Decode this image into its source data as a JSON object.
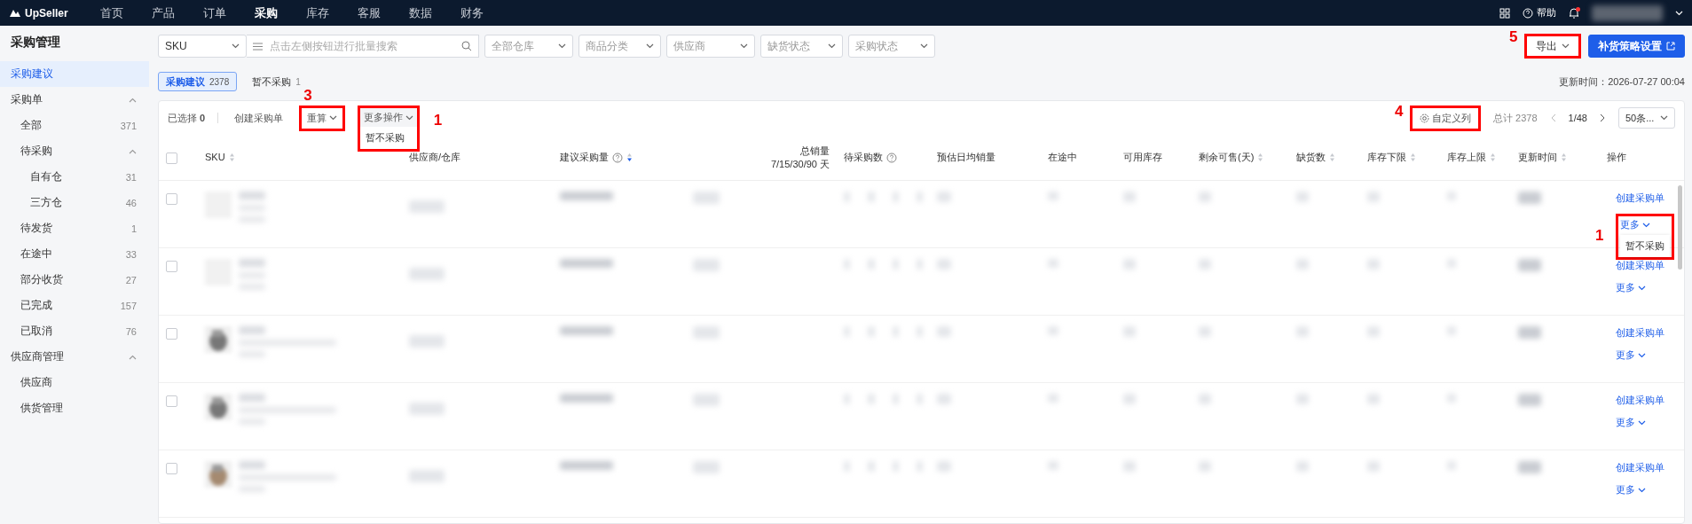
{
  "topbar": {
    "logo": "UpSeller",
    "nav": [
      {
        "label": "首页",
        "selected": false
      },
      {
        "label": "产品",
        "selected": false
      },
      {
        "label": "订单",
        "selected": false
      },
      {
        "label": "采购",
        "selected": true
      },
      {
        "label": "库存",
        "selected": false
      },
      {
        "label": "客服",
        "selected": false
      },
      {
        "label": "数据",
        "selected": false
      },
      {
        "label": "财务",
        "selected": false
      }
    ],
    "help": "帮助",
    "notification_dot": true
  },
  "sidebar": {
    "title": "采购管理",
    "items": [
      {
        "label": "采购建议",
        "selected": true
      },
      {
        "label": "采购单",
        "selected": false,
        "expanded": true,
        "children": [
          {
            "label": "全部",
            "count": "371",
            "selected": false
          },
          {
            "label": "待采购",
            "selected": false,
            "expanded": true,
            "children": [
              {
                "label": "自有仓",
                "count": "31",
                "selected": false
              },
              {
                "label": "三方仓",
                "count": "46",
                "selected": false
              }
            ]
          },
          {
            "label": "待发货",
            "count": "1",
            "selected": false
          },
          {
            "label": "在途中",
            "count": "33",
            "selected": false
          },
          {
            "label": "部分收货",
            "count": "27",
            "selected": false
          },
          {
            "label": "已完成",
            "count": "157",
            "selected": false
          },
          {
            "label": "已取消",
            "count": "76",
            "selected": false
          }
        ]
      },
      {
        "label": "供应商管理",
        "selected": false,
        "expanded": true,
        "children": [
          {
            "label": "供应商",
            "selected": false
          },
          {
            "label": "供货管理",
            "selected": false
          }
        ]
      }
    ]
  },
  "filters": {
    "search_type": "SKU",
    "search": {
      "placeholder": "点击左侧按钮进行批量搜索"
    },
    "selects": [
      {
        "placeholder": "全部仓库"
      },
      {
        "placeholder": "商品分类"
      },
      {
        "placeholder": "供应商"
      },
      {
        "placeholder": "缺货状态"
      },
      {
        "placeholder": "采购状态"
      }
    ],
    "export": {
      "label": "导出",
      "annotation": "5"
    },
    "strategy_button": "补货策略设置"
  },
  "tabs": [
    {
      "label": "采购建议",
      "count": "2378",
      "selected": true
    },
    {
      "label": "暂不采购",
      "count": "1",
      "selected": false
    }
  ],
  "update_time": "更新时间：2026-07-27 00:04",
  "toolbar": {
    "selected": "已选择 **0**",
    "create": "创建采购单",
    "recalc": {
      "label": "重算",
      "annotation": "3"
    },
    "more": {
      "label": "更多操作",
      "annotation": "1",
      "open": true,
      "menu": [
        "暂不采购"
      ]
    },
    "customize": {
      "label": "自定义列",
      "annotation": "4"
    },
    "total": "总计 2378",
    "page": "1/48",
    "page_size": "50条..."
  },
  "table": {
    "all_checked": false,
    "columns": [
      {
        "label": "SKU",
        "sortable": true,
        "sorted_descending": false
      },
      {
        "label": "供应商/仓库"
      },
      {
        "label": "建议采购量",
        "help": true,
        "sortable": true,
        "sorted_descending": true
      },
      {
        "label": "总销量",
        "sublabel": "7/15/30/90 天"
      },
      {
        "label": "待采购数",
        "help": true
      },
      {
        "label": "预估日均销量"
      },
      {
        "label": "在途中"
      },
      {
        "label": "可用库存"
      },
      {
        "label": "剩余可售(天)",
        "sortable": true,
        "sorted_descending": false
      },
      {
        "label": "缺货数",
        "sortable": true,
        "sorted_descending": false
      },
      {
        "label": "库存下限",
        "sortable": true,
        "sorted_descending": false
      },
      {
        "label": "库存上限",
        "sortable": true,
        "sorted_descending": false
      },
      {
        "label": "更新时间",
        "sortable": true,
        "sorted_descending": false
      },
      {
        "label": "操作"
      }
    ],
    "rows": [
      {
        "checked": false,
        "has_picture": false,
        "create": "创建采购单",
        "more": "更多",
        "annotation": "1",
        "menu": [
          "暂不采购"
        ]
      },
      {
        "checked": false,
        "has_picture": false,
        "create": "创建采购单",
        "more": "更多"
      },
      {
        "checked": false,
        "has_picture": true,
        "create": "创建采购单",
        "more": "更多"
      },
      {
        "checked": false,
        "has_picture": true,
        "create": "创建采购单",
        "more": "更多"
      },
      {
        "checked": false,
        "has_picture": true,
        "create": "创建采购单",
        "more": "更多"
      }
    ]
  }
}
